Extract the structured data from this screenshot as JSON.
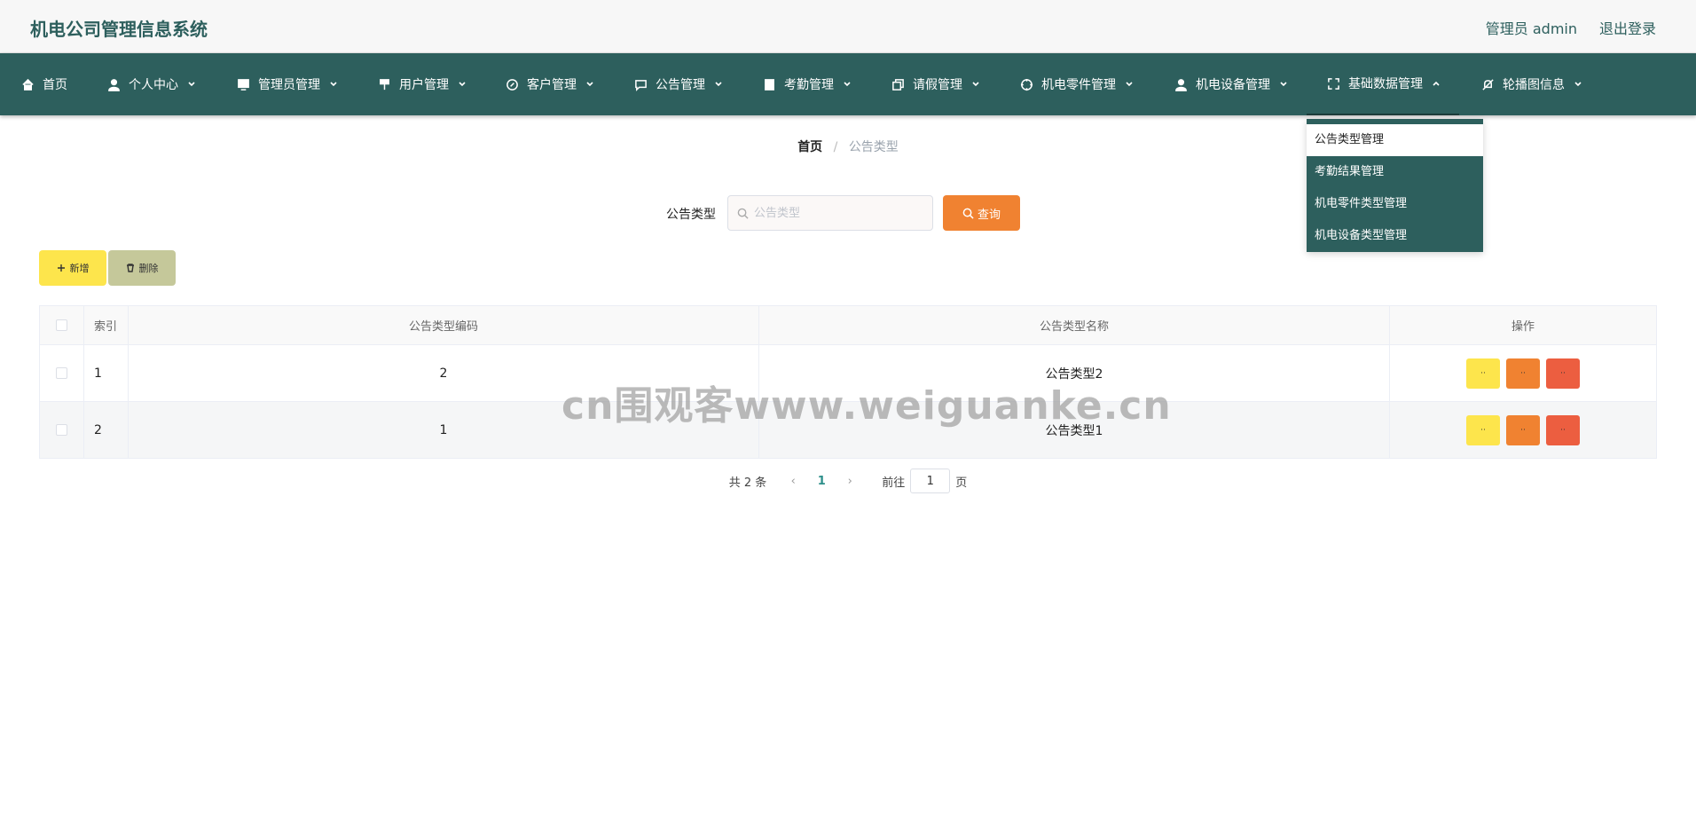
{
  "header": {
    "title": "机电公司管理信息系统",
    "admin": "管理员 admin",
    "logout": "退出登录"
  },
  "nav": [
    {
      "label": "首页",
      "icon": "home-icon"
    },
    {
      "label": "个人中心",
      "icon": "user-icon"
    },
    {
      "label": "管理员管理",
      "icon": "monitor-icon"
    },
    {
      "label": "用户管理",
      "icon": "brush-icon"
    },
    {
      "label": "客户管理",
      "icon": "compass-icon"
    },
    {
      "label": "公告管理",
      "icon": "chat-icon"
    },
    {
      "label": "考勤管理",
      "icon": "book-icon"
    },
    {
      "label": "请假管理",
      "icon": "copy-icon"
    },
    {
      "label": "机电零件管理",
      "icon": "aim-icon"
    },
    {
      "label": "机电设备管理",
      "icon": "user-icon"
    },
    {
      "label": "基础数据管理",
      "icon": "fullscreen-icon"
    },
    {
      "label": "轮播图信息",
      "icon": "bell-off-icon"
    }
  ],
  "dropdown": [
    "公告类型管理",
    "考勤结果管理",
    "机电零件类型管理",
    "机电设备类型管理"
  ],
  "breadcrumb": {
    "home": "首页",
    "sep": "/",
    "current": "公告类型"
  },
  "search": {
    "label": "公告类型",
    "placeholder": "公告类型",
    "button": "查询"
  },
  "actions": {
    "add": "新增",
    "delete": "删除"
  },
  "table": {
    "headers": [
      "索引",
      "公告类型编码",
      "公告类型名称",
      "操作"
    ],
    "rows": [
      {
        "index": "1",
        "code": "2",
        "name": "公告类型2"
      },
      {
        "index": "2",
        "code": "1",
        "name": "公告类型1"
      }
    ],
    "op_labels": {
      "view": "··",
      "edit": "··",
      "delete": "··"
    }
  },
  "pagination": {
    "total": "共 2 条",
    "current": "1",
    "goto": "前往",
    "page_value": "1",
    "page_unit": "页"
  },
  "watermark": "cn围观客www.weiguanke.cn",
  "colors": {
    "primary": "#2d5f5d",
    "orange": "#f08231",
    "yellow": "#fde54c",
    "red": "#ec5e40",
    "olive": "#c5c89a"
  }
}
